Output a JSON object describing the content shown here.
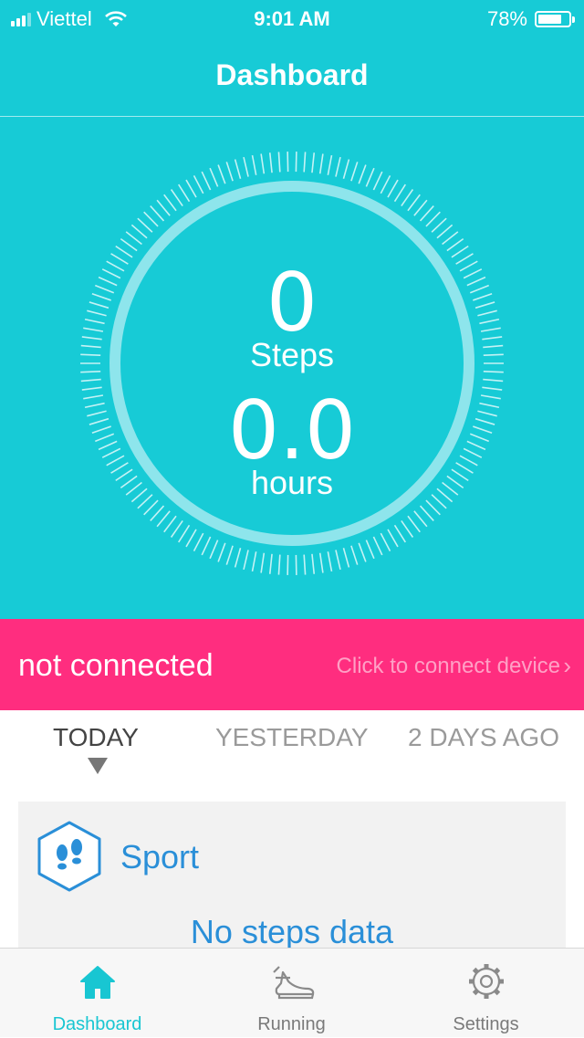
{
  "status_bar": {
    "carrier": "Viettel",
    "time": "9:01 AM",
    "battery": "78%",
    "battery_level": 0.78
  },
  "nav": {
    "title": "Dashboard"
  },
  "summary": {
    "steps_value": "0",
    "steps_label": "Steps",
    "hours_value": "0.0",
    "hours_label": "hours"
  },
  "connection": {
    "status": "not connected",
    "action": "Click to connect device",
    "chevron": "›"
  },
  "day_tabs": {
    "items": [
      "TODAY",
      "YESTERDAY",
      "2 DAYS AGO"
    ],
    "selected": "TODAY"
  },
  "sport_card": {
    "icon": "footprints-icon",
    "title": "Sport",
    "empty_message": "No steps data"
  },
  "tab_bar": {
    "items": [
      {
        "label": "Dashboard",
        "icon": "home-icon",
        "selected": true
      },
      {
        "label": "Running",
        "icon": "shoe-icon",
        "selected": false
      },
      {
        "label": "Settings",
        "icon": "gear-icon",
        "selected": false
      }
    ]
  },
  "colors": {
    "teal": "#17cbd6",
    "pink": "#ff2d7f",
    "blue": "#2a8fd8",
    "card": "#f2f2f2"
  }
}
